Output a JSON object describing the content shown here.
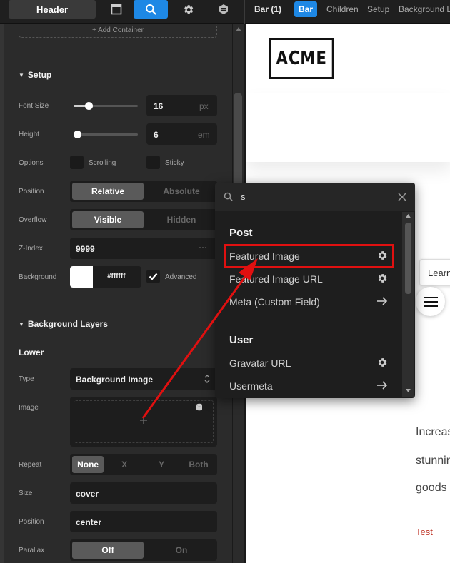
{
  "topbar": {
    "header_label": "Header",
    "tabs": [
      "layout-icon",
      "search-icon",
      "gear-icon",
      "component-icon"
    ],
    "active_tab": "search-icon",
    "bar_count_label": "Bar (1)",
    "bar_label": "Bar",
    "links": [
      "Children",
      "Setup",
      "Background L"
    ]
  },
  "panel": {
    "add_container_label": "+ Add Container",
    "setup": {
      "title": "Setup",
      "font_size": {
        "label": "Font Size",
        "value": "16",
        "unit": "px",
        "slider": 0.23
      },
      "height": {
        "label": "Height",
        "value": "6",
        "unit": "em",
        "slider": 0.05
      },
      "options": {
        "label": "Options",
        "items": [
          "Scrolling",
          "Sticky"
        ]
      },
      "position": {
        "label": "Position",
        "options": [
          "Relative",
          "Absolute"
        ],
        "selected": "Relative"
      },
      "overflow": {
        "label": "Overflow",
        "options": [
          "Visible",
          "Hidden"
        ],
        "selected": "Visible"
      },
      "z_index": {
        "label": "Z-Index",
        "value": "9999",
        "more": "···"
      },
      "background": {
        "label": "Background",
        "value": "#ffffff",
        "advanced": "Advanced",
        "advanced_checked": true,
        "swatch": "#ffffff"
      }
    },
    "bg_layers": {
      "title": "Background Layers",
      "lower": "Lower",
      "type": {
        "label": "Type",
        "value": "Background Image"
      },
      "image": {
        "label": "Image"
      },
      "repeat": {
        "label": "Repeat",
        "options": [
          "None",
          "X",
          "Y",
          "Both"
        ],
        "selected": "None"
      },
      "size": {
        "label": "Size",
        "value": "cover"
      },
      "position": {
        "label": "Position",
        "value": "center"
      },
      "parallax": {
        "label": "Parallax",
        "options": [
          "Off",
          "On"
        ],
        "selected": "Off"
      }
    }
  },
  "popup": {
    "query": "s",
    "groups": [
      {
        "title": "Post",
        "items": [
          {
            "label": "Featured Image",
            "icon": "gear-icon"
          },
          {
            "label": "Featured Image URL",
            "icon": "gear-icon"
          },
          {
            "label": "Meta (Custom Field)",
            "icon": "arrow-right-icon"
          }
        ]
      },
      {
        "title": "User",
        "items": [
          {
            "label": "Gravatar URL",
            "icon": "gear-icon"
          },
          {
            "label": "Usermeta",
            "icon": "arrow-right-icon"
          }
        ]
      }
    ]
  },
  "site": {
    "logo": "ACME",
    "learn_label": "Learn",
    "body_lines": [
      "Increas",
      "stunnin",
      "goods"
    ],
    "test_label": "Test"
  },
  "colors": {
    "accent": "#1e88e5",
    "annotation": "#e01010"
  }
}
